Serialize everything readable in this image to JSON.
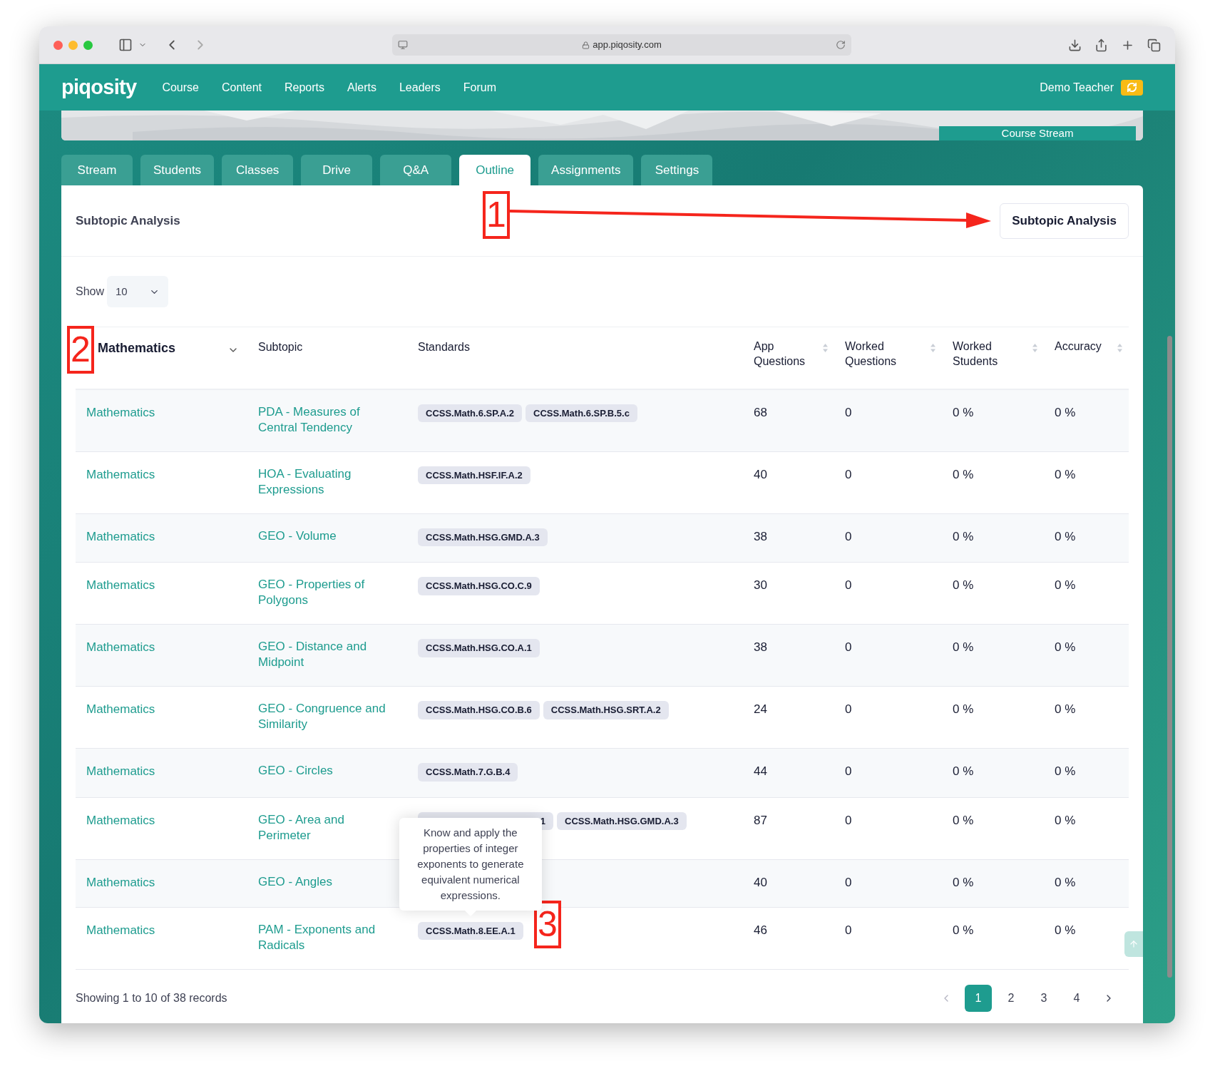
{
  "browser": {
    "url": "app.piqosity.com"
  },
  "nav": {
    "logo": "piqosity",
    "items": [
      "Course",
      "Content",
      "Reports",
      "Alerts",
      "Leaders",
      "Forum"
    ],
    "user": "Demo Teacher"
  },
  "banner": {
    "label": "Course Stream"
  },
  "tabs": [
    {
      "label": "Stream",
      "selected": false
    },
    {
      "label": "Students",
      "selected": false
    },
    {
      "label": "Classes",
      "selected": false
    },
    {
      "label": "Drive",
      "selected": false
    },
    {
      "label": "Q&A",
      "selected": false
    },
    {
      "label": "Outline",
      "selected": true
    },
    {
      "label": "Assignments",
      "selected": false
    },
    {
      "label": "Settings",
      "selected": false
    }
  ],
  "panel": {
    "title": "Subtopic Analysis",
    "button": "Subtopic Analysis"
  },
  "show": {
    "label": "Show",
    "value": "10"
  },
  "table": {
    "columns": [
      {
        "label": "Mathematics",
        "kind": "filter"
      },
      {
        "label": "Subtopic",
        "kind": "plain"
      },
      {
        "label": "Standards",
        "kind": "plain"
      },
      {
        "label": "App Questions",
        "kind": "sortable"
      },
      {
        "label": "Worked Questions",
        "kind": "sortable"
      },
      {
        "label": "Worked Students",
        "kind": "sortable"
      },
      {
        "label": "Accuracy",
        "kind": "sortable"
      }
    ],
    "rows": [
      {
        "subject": "Mathematics",
        "subtopic": "PDA - Measures of Central Tendency",
        "standards": [
          {
            "code": "CCSS.Math.6.SP.A.2"
          },
          {
            "code": "CCSS.Math.6.SP.B.5.c"
          }
        ],
        "app_questions": "68",
        "worked_questions": "0",
        "worked_students": "0 %",
        "accuracy": "0 %"
      },
      {
        "subject": "Mathematics",
        "subtopic": "HOA - Evaluating Expressions",
        "standards": [
          {
            "code": "CCSS.Math.HSF.IF.A.2"
          }
        ],
        "app_questions": "40",
        "worked_questions": "0",
        "worked_students": "0 %",
        "accuracy": "0 %"
      },
      {
        "subject": "Mathematics",
        "subtopic": "GEO - Volume",
        "standards": [
          {
            "code": "CCSS.Math.HSG.GMD.A.3"
          }
        ],
        "app_questions": "38",
        "worked_questions": "0",
        "worked_students": "0 %",
        "accuracy": "0 %"
      },
      {
        "subject": "Mathematics",
        "subtopic": "GEO - Properties of Polygons",
        "standards": [
          {
            "code": "CCSS.Math.HSG.CO.C.9"
          }
        ],
        "app_questions": "30",
        "worked_questions": "0",
        "worked_students": "0 %",
        "accuracy": "0 %"
      },
      {
        "subject": "Mathematics",
        "subtopic": "GEO - Distance and Midpoint",
        "standards": [
          {
            "code": "CCSS.Math.HSG.CO.A.1"
          }
        ],
        "app_questions": "38",
        "worked_questions": "0",
        "worked_students": "0 %",
        "accuracy": "0 %"
      },
      {
        "subject": "Mathematics",
        "subtopic": "GEO - Congruence and Similarity",
        "standards": [
          {
            "code": "CCSS.Math.HSG.CO.B.6"
          },
          {
            "code": "CCSS.Math.HSG.SRT.A.2"
          }
        ],
        "app_questions": "24",
        "worked_questions": "0",
        "worked_students": "0 %",
        "accuracy": "0 %"
      },
      {
        "subject": "Mathematics",
        "subtopic": "GEO - Circles",
        "standards": [
          {
            "code": "CCSS.Math.7.G.B.4"
          }
        ],
        "app_questions": "44",
        "worked_questions": "0",
        "worked_students": "0 %",
        "accuracy": "0 %"
      },
      {
        "subject": "Mathematics",
        "subtopic": "GEO - Area and Perimeter",
        "standards": [
          {
            "code": "1",
            "covered": true
          },
          {
            "code": "CCSS.Math.HSG.GMD.A.3"
          }
        ],
        "app_questions": "87",
        "worked_questions": "0",
        "worked_students": "0 %",
        "accuracy": "0 %"
      },
      {
        "subject": "Mathematics",
        "subtopic": "GEO - Angles",
        "standards": [],
        "app_questions": "40",
        "worked_questions": "0",
        "worked_students": "0 %",
        "accuracy": "0 %"
      },
      {
        "subject": "Mathematics",
        "subtopic": "PAM - Exponents and Radicals",
        "standards": [
          {
            "code": "CCSS.Math.8.EE.A.1",
            "tooltip": "Know and apply the properties of integer exponents to generate equivalent numerical expressions."
          }
        ],
        "app_questions": "46",
        "worked_questions": "0",
        "worked_students": "0 %",
        "accuracy": "0 %"
      }
    ]
  },
  "footer": {
    "summary": "Showing 1 to 10 of 38 records",
    "pages": [
      {
        "label": "1",
        "selected": true
      },
      {
        "label": "2",
        "selected": false
      },
      {
        "label": "3",
        "selected": false
      },
      {
        "label": "4",
        "selected": false
      }
    ]
  },
  "annotations": [
    {
      "label": "1"
    },
    {
      "label": "2"
    },
    {
      "label": "3"
    }
  ]
}
